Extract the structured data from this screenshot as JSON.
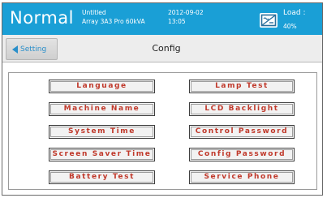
{
  "header": {
    "mode": "Normal",
    "project": "Untitled",
    "model": "Array 3A3 Pro 60kVA",
    "date": "2012-09-02",
    "time": "13:05",
    "load_label": "Load :",
    "load_value": "40%",
    "icon": "inverter-icon"
  },
  "nav": {
    "back_label": "Setting",
    "title": "Config"
  },
  "config_buttons": {
    "language": "Language",
    "machine_name": "Machine Name",
    "system_time": "System Time",
    "screen_saver_time": "Screen Saver Time",
    "battery_test": "Battery Test",
    "lamp_test": "Lamp Test",
    "lcd_backlight": "LCD Backlight",
    "control_password": "Control Password",
    "config_password": "Config Password",
    "service_phone": "Service Phone"
  },
  "colors": {
    "header_bg": "#1a9fd6",
    "button_text": "#c0392b",
    "back_accent": "#2a8fca"
  }
}
